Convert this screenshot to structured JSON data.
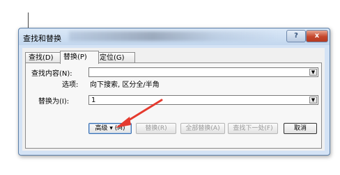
{
  "dialog": {
    "title": "查找和替换",
    "help_button": "?",
    "close_button": "x"
  },
  "tabs": [
    {
      "label": "查找(D)",
      "active": false
    },
    {
      "label": "替换(P)",
      "active": true
    },
    {
      "label": "定位(G)",
      "active": false
    }
  ],
  "find": {
    "label": "查找内容(N):",
    "value": "",
    "options_label": "选项:",
    "options_value": "向下搜索, 区分全/半角"
  },
  "replace": {
    "label": "替换为(I):",
    "value": "1"
  },
  "buttons": {
    "more": "高级 ▾ (M)",
    "replace": "替换(R)",
    "replace_all": "全部替换(A)",
    "find_next": "查找下一处(F)",
    "cancel": "取消"
  },
  "colors": {
    "annotation_arrow": "#e53a2e"
  }
}
